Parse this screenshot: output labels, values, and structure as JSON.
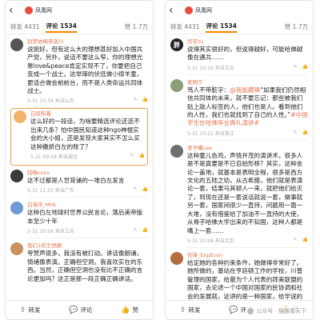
{
  "left": {
    "site_name": "凤凰网",
    "tabs": {
      "repost": "转发 4431",
      "comment": "评论 1534",
      "likes": "赞 1.7万"
    },
    "comments": [
      {
        "name": "别梦依稀笑逝川",
        "text": "说挺好，但有这么大的理想甚好加入中国共产党，另外，说话不要这么窄，你的理想光靠love&peace肯定实现不了，你要把自己变成一个战士。这举琢的伏低做小绵羊童，更适合做会前前台，而不是人类命运共同体战士。",
        "time": "5-31 10:34",
        "ip": "来自山东",
        "avatar_color": "#555555",
        "avatar_text": ""
      },
      {
        "name": "白饭知着",
        "text": "这么好的一段话，为啥要精选评论还选不出来几条？怕中国民知道这种ngo神棍实会的大小姐，还是发现大家其实不怎么买这种撒娇白左的账了？",
        "time": "5-31 09:58",
        "ip": "来自湖北",
        "avatar_color": "#f2b46a",
        "avatar_text": "",
        "highlight": true
      },
      {
        "name": "陆畅cxxx",
        "text": "这不过都是人世背诵的一堆白左发言",
        "time": "5-31 11:25",
        "ip": "来自广东",
        "avatar_color": "#3a3a3a",
        "avatar_text": ""
      },
      {
        "name": "白海市_MHL",
        "text": "这种白左地球村世界公民言论，落后美帝版本至少十年",
        "time": "5-31 10:56",
        "ip": "来自江苏",
        "avatar_color": "#6d9bd1",
        "avatar_text": ""
      },
      {
        "name": "我们1班王悦娜",
        "text": "夸赞声很多，我没有被打动。讲话像朗诵，情绪像表演。正确但空洞。我喜欢实在的东西。当然，正确但空洞也没有比不正确的言论更加吗？这正是那一段正确正确讲话。",
        "time": "5-31 10:12",
        "ip": "来自北京",
        "avatar_color": "#c9925f",
        "avatar_text": ""
      }
    ],
    "bottom": {
      "repost": "转发",
      "comment": "评论",
      "like": "赞"
    }
  },
  "right": {
    "site_name": "凤凰网",
    "tabs": {
      "repost": "转发 4431",
      "comment": "评论 1534",
      "likes": "赞 1.7万"
    },
    "comments": [
      {
        "name": "月宅Yu",
        "text": "说得其实很好的，但说得越好，可能哈佛越像在遇共……",
        "time": "5-31 10:26",
        "ip": "来自江苏",
        "avatar_color": "#222222",
        "avatar_text": "胖"
      },
      {
        "name": "老网宁",
        "mention": "@我能藏锋",
        "text_before": "笃人不带脏字：",
        "text_after": "“如果我们仍然相信共同体的未来，就不要忘记：那些被我们贴上敌人标签的人，他们也是人。看到他们的人性，我们也就找到了自己的人性。”",
        "hashtag": "#中国学生在哈佛毕业典礼演讲#",
        "time": "5-31 10:22",
        "ip": "来自浙江",
        "avatar_color": "#8a9e7b",
        "avatar_text": ""
      },
      {
        "name": "李子曦Lee",
        "text": "这种童儿色鸡，声情并茂的演讲术，很多人是不是真要是不已自拍形移？其实，这种言论一盖地，就基本是表明全程，很多是西方文化的五陆之劝，从古希腊，他们就是表演论一套，结果马其顿人一来，就把他们给灭了，到现在还是一套说话就说一套，做事就另一套，国家间很少一直持，问题用一面一大堆，没有借鉴给了加油不一直持的大使，从骨子哈佛大学出来的不知国，这种人都是嘴上一套……",
        "time": "5-31 10:58",
        "ip": "来自北京",
        "avatar_color": "#6f6f6f",
        "avatar_text": ""
      },
      {
        "name": "包锋_ExpEcon",
        "text": "给定她的各种约束条件，她做得非常好了。她所做的，基站在亨廷顿工作的学校，川普管理的国家，给最为个人代表的拜美联盟的国家，去论述一个中国对国家的民协调和社会的发展就，这讲的是一种国家，给学说的一带一路本身的社会，她……是穿汉不忘，给吾国发展与命运共同体精神的中国……",
        "time": "5-31 10:43",
        "ip": "来自北京",
        "avatar_color": "#b46e3f",
        "avatar_text": ""
      }
    ],
    "bottom": {
      "repost": "转发",
      "comment": "评论",
      "like": "赞"
    }
  },
  "watermark": "公众号 · 猫眼看天下"
}
